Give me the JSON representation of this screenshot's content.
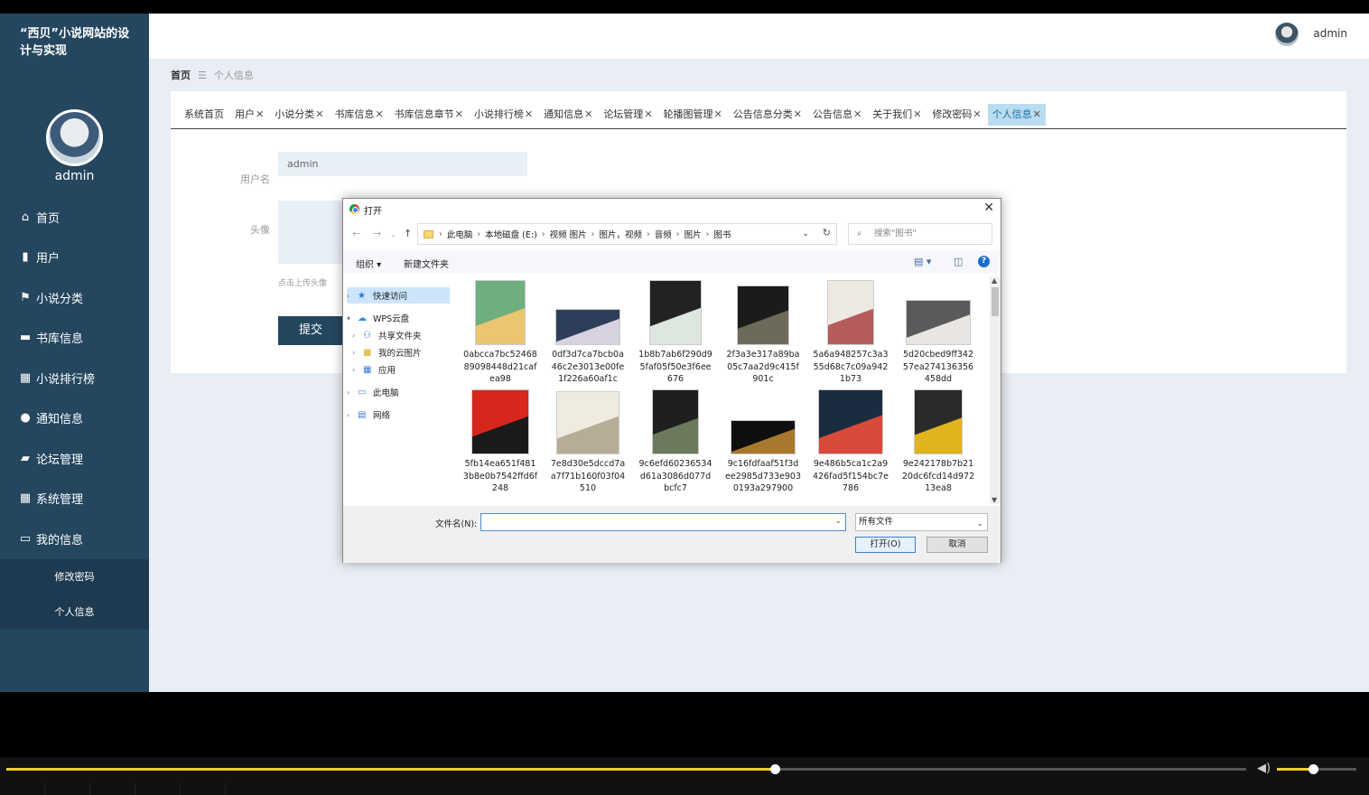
{
  "site": {
    "title": "“西贝”小说网站的设计与实现",
    "sidebar_user": "admin"
  },
  "menu": [
    {
      "label": "首页",
      "icon": "home-icon",
      "glyph": "⌂"
    },
    {
      "label": "用户",
      "icon": "user-book-icon",
      "glyph": "▮"
    },
    {
      "label": "小说分类",
      "icon": "flag-icon",
      "glyph": "⚑"
    },
    {
      "label": "书库信息",
      "icon": "chat-icon",
      "glyph": "▬"
    },
    {
      "label": "小说排行榜",
      "icon": "grid-icon",
      "glyph": "▦"
    },
    {
      "label": "通知信息",
      "icon": "bulb-icon",
      "glyph": "●"
    },
    {
      "label": "论坛管理",
      "icon": "wallet-icon",
      "glyph": "▰"
    },
    {
      "label": "系统管理",
      "icon": "grid-icon",
      "glyph": "▦"
    },
    {
      "label": "我的信息",
      "icon": "card-icon",
      "glyph": "▭"
    }
  ],
  "submenu": [
    "修改密码",
    "个人信息"
  ],
  "header": {
    "user": "admin"
  },
  "breadcrumb": {
    "home": "首页",
    "sep": "☰",
    "current": "个人信息"
  },
  "tabs": [
    {
      "label": "系统首页",
      "close": false
    },
    {
      "label": "用户",
      "close": true
    },
    {
      "label": "小说分类",
      "close": true
    },
    {
      "label": "书库信息",
      "close": true
    },
    {
      "label": "书库信息章节",
      "close": true
    },
    {
      "label": "小说排行榜",
      "close": true
    },
    {
      "label": "通知信息",
      "close": true
    },
    {
      "label": "论坛管理",
      "close": true
    },
    {
      "label": "轮播图管理",
      "close": true
    },
    {
      "label": "公告信息分类",
      "close": true
    },
    {
      "label": "公告信息",
      "close": true
    },
    {
      "label": "关于我们",
      "close": true
    },
    {
      "label": "修改密码",
      "close": true
    },
    {
      "label": "个人信息",
      "close": true,
      "active": true
    }
  ],
  "form": {
    "username_label": "用户名",
    "username_value": "admin",
    "avatar_label": "头像",
    "upload_hint": "点击上传头像",
    "submit": "提交"
  },
  "dialog": {
    "title": "打开",
    "path": [
      "此电脑",
      "本地磁盘 (E:)",
      "视频 图片",
      "图片，视频",
      "音频",
      "图片",
      "图书"
    ],
    "search_placeholder": "搜索\"图书\"",
    "organize": "组织 ▾",
    "new_folder": "新建文件夹",
    "tree": [
      {
        "label": "快速访问",
        "level": 0,
        "selected": true
      },
      {
        "label": "WPS云盘",
        "level": 0,
        "expanded": true
      },
      {
        "label": "共享文件夹",
        "level": 1
      },
      {
        "label": "我的云图片",
        "level": 1
      },
      {
        "label": "应用",
        "level": 1
      },
      {
        "label": "此电脑",
        "level": 0
      },
      {
        "label": "网络",
        "level": 0
      }
    ],
    "files": [
      {
        "name": "0abcca7bc5246889098448d21cafea98",
        "colors": [
          "#6fae7f",
          "#e9c66f"
        ]
      },
      {
        "name": "0df3d7ca7bcb0a46c2e3013e00fe1f226a60af1c",
        "colors": [
          "#2e3e59",
          "#d7d2e2"
        ]
      },
      {
        "name": "1b8b7ab6f290d95faf05f50e3f6ee676",
        "colors": [
          "#222222",
          "#dde7e0"
        ]
      },
      {
        "name": "2f3a3e317a89ba05c7aa2d9c415f901c",
        "colors": [
          "#1b1b1b",
          "#6d6a5a"
        ]
      },
      {
        "name": "5a6a948257c3a355d68c7c09a9421b73",
        "colors": [
          "#eeeae3",
          "#b45c5c"
        ]
      },
      {
        "name": "5d20cbed9ff34257ea274136356458dd",
        "colors": [
          "#5a5a5a",
          "#e9e6e1"
        ]
      },
      {
        "name": "5fb14ea651f4813b8e0b7542ffd6f248",
        "colors": [
          "#d8261c",
          "#1a1a1a"
        ]
      },
      {
        "name": "7e8d30e5dccd7aa7f71b160f03f04510",
        "colors": [
          "#efebe0",
          "#b7ad96"
        ]
      },
      {
        "name": "9c6efd60236534d61a3086d077dbcfc7",
        "colors": [
          "#1f1f1f",
          "#6b7a5d"
        ]
      },
      {
        "name": "9c16fdfaaf51f3dee2985d733e9030193a297900",
        "colors": [
          "#0f0f0f",
          "#a7782e"
        ]
      },
      {
        "name": "9e486b5ca1c2a9426fad5f154bc7e786",
        "colors": [
          "#1c2c3f",
          "#d94a3a"
        ]
      },
      {
        "name": "9e242178b7b2120dc6fcd14d97213ea8",
        "colors": [
          "#2a2a2a",
          "#e0b31f"
        ]
      }
    ],
    "filename_label": "文件名(N):",
    "filename_value": "",
    "filter": "所有文件",
    "open": "打开(O)",
    "cancel": "取消"
  },
  "player": {
    "progress": 0.62,
    "volume": 0.45,
    "accent": "#f2d02b"
  }
}
